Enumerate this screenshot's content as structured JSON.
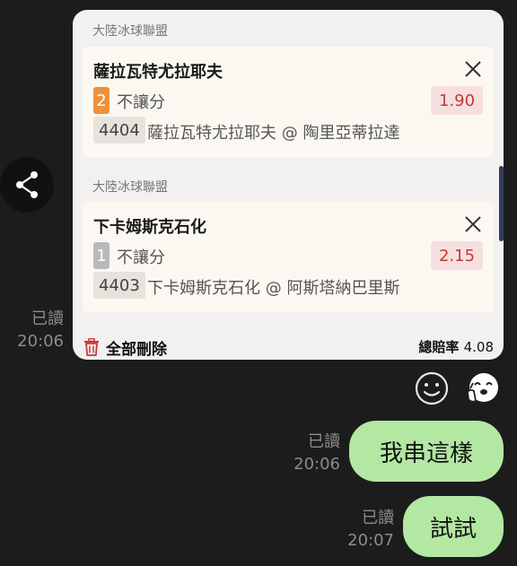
{
  "bets": [
    {
      "league": "大陸冰球聯盟",
      "team": "薩拉瓦特尤拉耶夫",
      "badge": "2",
      "badge_color": "#f0903a",
      "bet_type": "不讓分",
      "odds": "1.90",
      "code": "4404",
      "match": "薩拉瓦特尤拉耶夫 @ 陶里亞蒂拉達"
    },
    {
      "league": "大陸冰球聯盟",
      "team": "下卡姆斯克石化",
      "badge": "1",
      "badge_color": "#b9b9b9",
      "bet_type": "不讓分",
      "odds": "2.15",
      "code": "4403",
      "match": "下卡姆斯克石化 @ 阿斯塔納巴里斯"
    }
  ],
  "footer": {
    "delete_all": "全部刪除",
    "total_odds_label": "總賠率",
    "total_odds": "4.08"
  },
  "messages": [
    {
      "read": "已讀",
      "time": "20:06"
    },
    {
      "read": "已讀",
      "time": "20:06",
      "text": "我串這樣"
    },
    {
      "read": "已讀",
      "time": "20:07",
      "text": "試試"
    }
  ],
  "colors": {
    "background": "#1c1c1c",
    "bubble": "#b3e8a3",
    "odds_text": "#c43a38"
  },
  "icons": [
    "share-icon",
    "close-icon",
    "trash-icon",
    "smiley-icon",
    "sticker-icon"
  ]
}
